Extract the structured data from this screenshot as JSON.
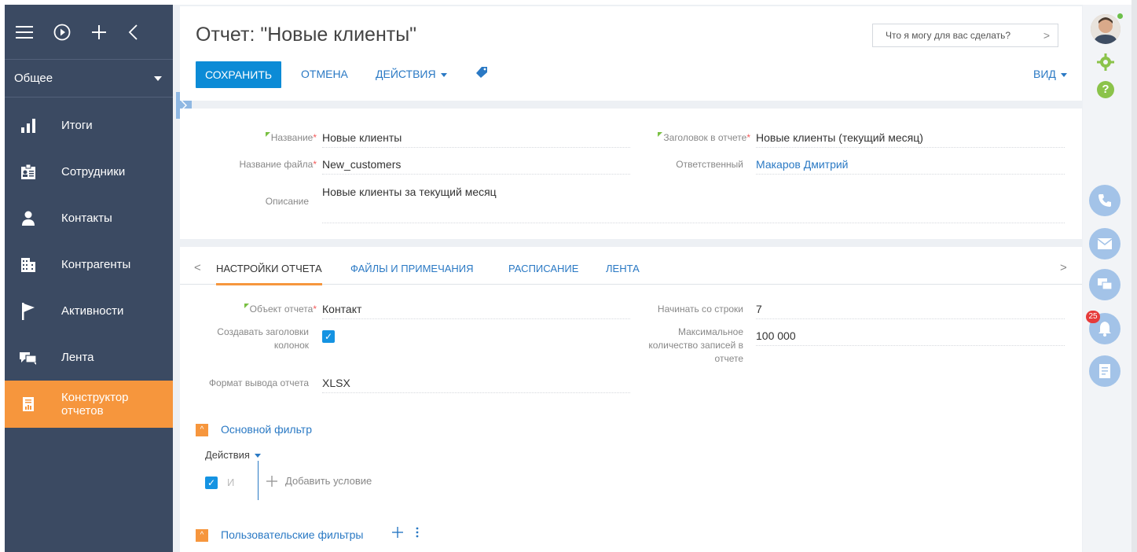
{
  "sidebar": {
    "section": "Общее",
    "items": [
      {
        "label": "Итоги",
        "icon": "bar-chart-icon"
      },
      {
        "label": "Сотрудники",
        "icon": "employee-card-icon"
      },
      {
        "label": "Контакты",
        "icon": "person-icon"
      },
      {
        "label": "Контрагенты",
        "icon": "building-icon"
      },
      {
        "label": "Активности",
        "icon": "flag-icon"
      },
      {
        "label": "Лента",
        "icon": "chat-icon"
      },
      {
        "label": "Конструктор отчетов",
        "icon": "report-icon",
        "active": true
      }
    ]
  },
  "header": {
    "title": "Отчет: \"Новые клиенты\"",
    "search_placeholder": "Что я могу для вас сделать?",
    "save": "СОХРАНИТЬ",
    "cancel": "ОТМЕНА",
    "actions": "ДЕЙСТВИЯ",
    "view": "ВИД"
  },
  "form": {
    "name_label": "Название",
    "name_value": "Новые клиенты",
    "filename_label": "Название файла",
    "filename_value": "New_customers",
    "description_label": "Описание",
    "description_value": "Новые клиенты за текущий месяц",
    "report_title_label": "Заголовок в отчете",
    "report_title_value": "Новые клиенты (текущий месяц)",
    "owner_label": "Ответственный",
    "owner_value": "Макаров Дмитрий"
  },
  "tabs": [
    {
      "label": "НАСТРОЙКИ ОТЧЕТА",
      "active": true
    },
    {
      "label": "ФАЙЛЫ И ПРИМЕЧАНИЯ"
    },
    {
      "label": "РАСПИСАНИЕ"
    },
    {
      "label": "ЛЕНТА"
    }
  ],
  "settings": {
    "object_label": "Объект отчета",
    "object_value": "Контакт",
    "headers_label_1": "Создавать заголовки",
    "headers_label_2": "колонок",
    "headers_checked": true,
    "format_label": "Формат вывода отчета",
    "format_value": "XLSX",
    "start_row_label": "Начинать со строки",
    "start_row_value": "7",
    "max_label_1": "Максимальное",
    "max_label_2": "количество записей в",
    "max_label_3": "отчете",
    "max_value": "100 000"
  },
  "filters": {
    "main_filter": "Основной фильтр",
    "actions": "Действия",
    "and_label": "И",
    "add_condition": "Добавить условие",
    "user_filters": "Пользовательские фильтры"
  },
  "rail": {
    "notifications_count": "25"
  }
}
